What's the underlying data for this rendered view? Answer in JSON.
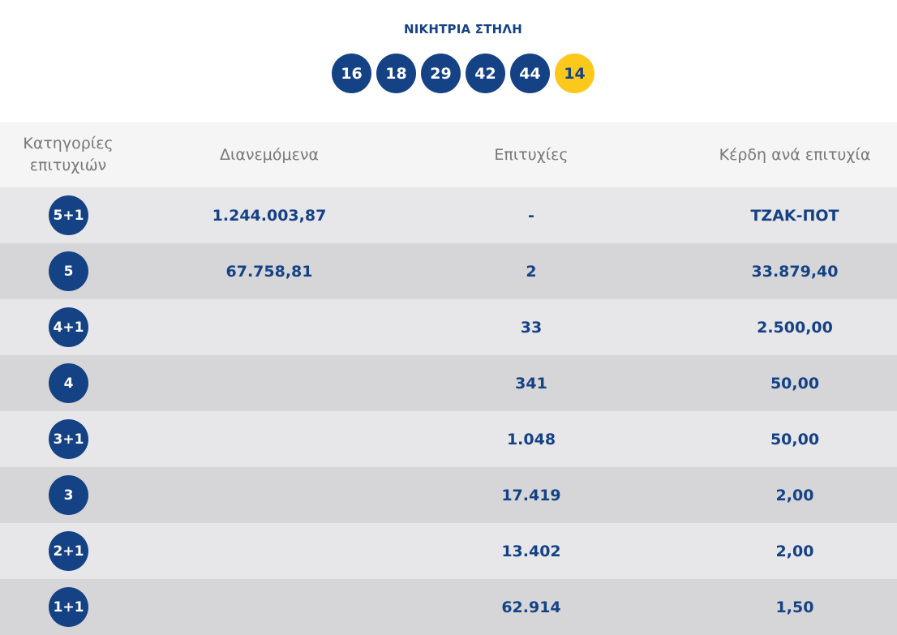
{
  "winning": {
    "title": "ΝΙΚΗΤΡΙΑ ΣΤΗΛΗ",
    "numbers": [
      "16",
      "18",
      "29",
      "42",
      "44"
    ],
    "bonus": "14"
  },
  "table": {
    "headers": {
      "category": "Κατηγορίες επιτυχιών",
      "distributed": "Διανεμόμενα",
      "winners": "Επιτυχίες",
      "prize": "Κέρδη ανά επιτυχία"
    },
    "rows": [
      {
        "category": "5+1",
        "distributed": "1.244.003,87",
        "winners": "-",
        "prize": "ΤΖΑΚ-ΠΟΤ"
      },
      {
        "category": "5",
        "distributed": "67.758,81",
        "winners": "2",
        "prize": "33.879,40"
      },
      {
        "category": "4+1",
        "distributed": "",
        "winners": "33",
        "prize": "2.500,00"
      },
      {
        "category": "4",
        "distributed": "",
        "winners": "341",
        "prize": "50,00"
      },
      {
        "category": "3+1",
        "distributed": "",
        "winners": "1.048",
        "prize": "50,00"
      },
      {
        "category": "3",
        "distributed": "",
        "winners": "17.419",
        "prize": "2,00"
      },
      {
        "category": "2+1",
        "distributed": "",
        "winners": "13.402",
        "prize": "2,00"
      },
      {
        "category": "1+1",
        "distributed": "",
        "winners": "62.914",
        "prize": "1,50"
      }
    ]
  },
  "colors": {
    "primary_blue": "#154284",
    "bonus_yellow": "#fcc81b",
    "row_light": "#e7e7ea",
    "row_dark": "#d6d6d9",
    "header_bg": "#f5f5f5",
    "header_text": "#777777"
  }
}
